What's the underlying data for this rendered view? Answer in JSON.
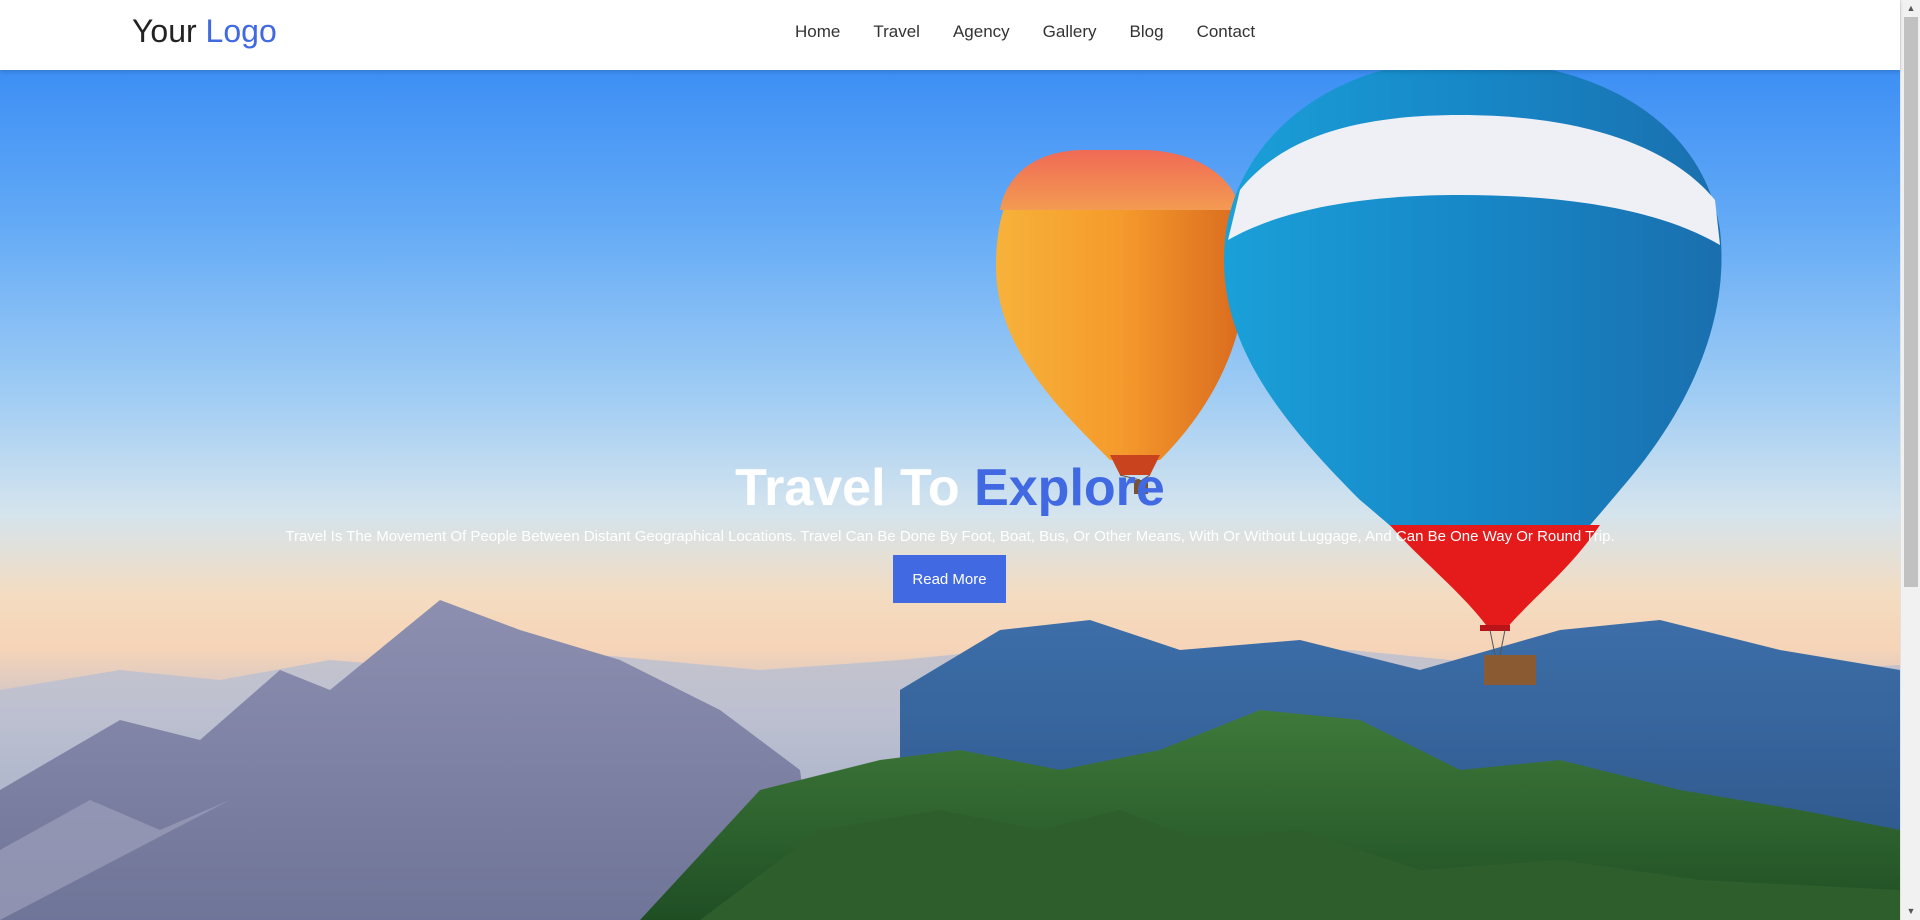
{
  "header": {
    "logo_prefix": "Your",
    "logo_accent": "Logo",
    "nav": [
      {
        "label": "Home"
      },
      {
        "label": "Travel"
      },
      {
        "label": "Agency"
      },
      {
        "label": "Gallery"
      },
      {
        "label": "Blog"
      },
      {
        "label": "Contact"
      }
    ]
  },
  "hero": {
    "title_prefix": "Travel To",
    "title_accent": "Explore",
    "subtitle": "Travel Is The Movement Of People Between Distant Geographical Locations. Travel Can Be Done By Foot, Boat, Bus, Or Other Means, With Or Without Luggage, And Can Be One Way Or Round Trip.",
    "button_label": "Read More",
    "background_image": "hot-air-balloons-over-mountains"
  },
  "colors": {
    "accent": "#4169e1",
    "header_bg": "#ffffff",
    "hero_text": "#ffffff"
  },
  "scrollbar": {
    "up_icon": "chevron-up-icon",
    "down_icon": "chevron-down-icon"
  }
}
